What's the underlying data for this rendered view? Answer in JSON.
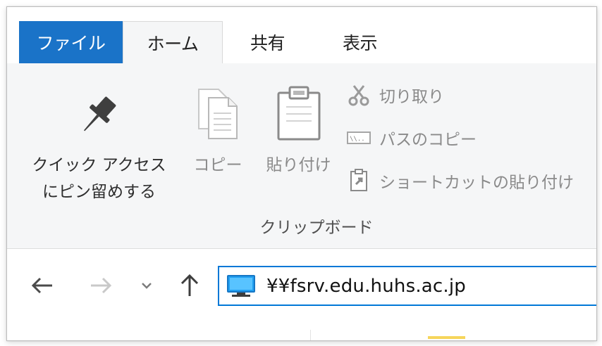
{
  "tabs": {
    "file": "ファイル",
    "home": "ホーム",
    "share": "共有",
    "view": "表示"
  },
  "clipboard": {
    "group_label": "クリップボード",
    "pin_label_line1": "クイック アクセス",
    "pin_label_line2": "にピン留めする",
    "copy_label": "コピー",
    "paste_label": "貼り付け",
    "cut_label": "切り取り",
    "copy_path_label": "パスのコピー",
    "paste_shortcut_label": "ショートカットの貼り付け"
  },
  "navigation": {
    "address": "¥¥fsrv.edu.huhs.ac.jp"
  },
  "icons": {
    "pin": "pin-icon",
    "copy": "copy-icon",
    "paste": "paste-icon",
    "cut": "scissors-icon",
    "copy_path": "path-icon",
    "paste_shortcut": "shortcut-icon",
    "computer": "computer-icon",
    "back": "arrow-left-icon",
    "forward": "arrow-right-icon",
    "recent": "chevron-down-icon",
    "up": "arrow-up-icon"
  },
  "colors": {
    "file_tab": "#1a73c8",
    "ribbon": "#f5f6f7",
    "address_border": "#0078d7"
  }
}
